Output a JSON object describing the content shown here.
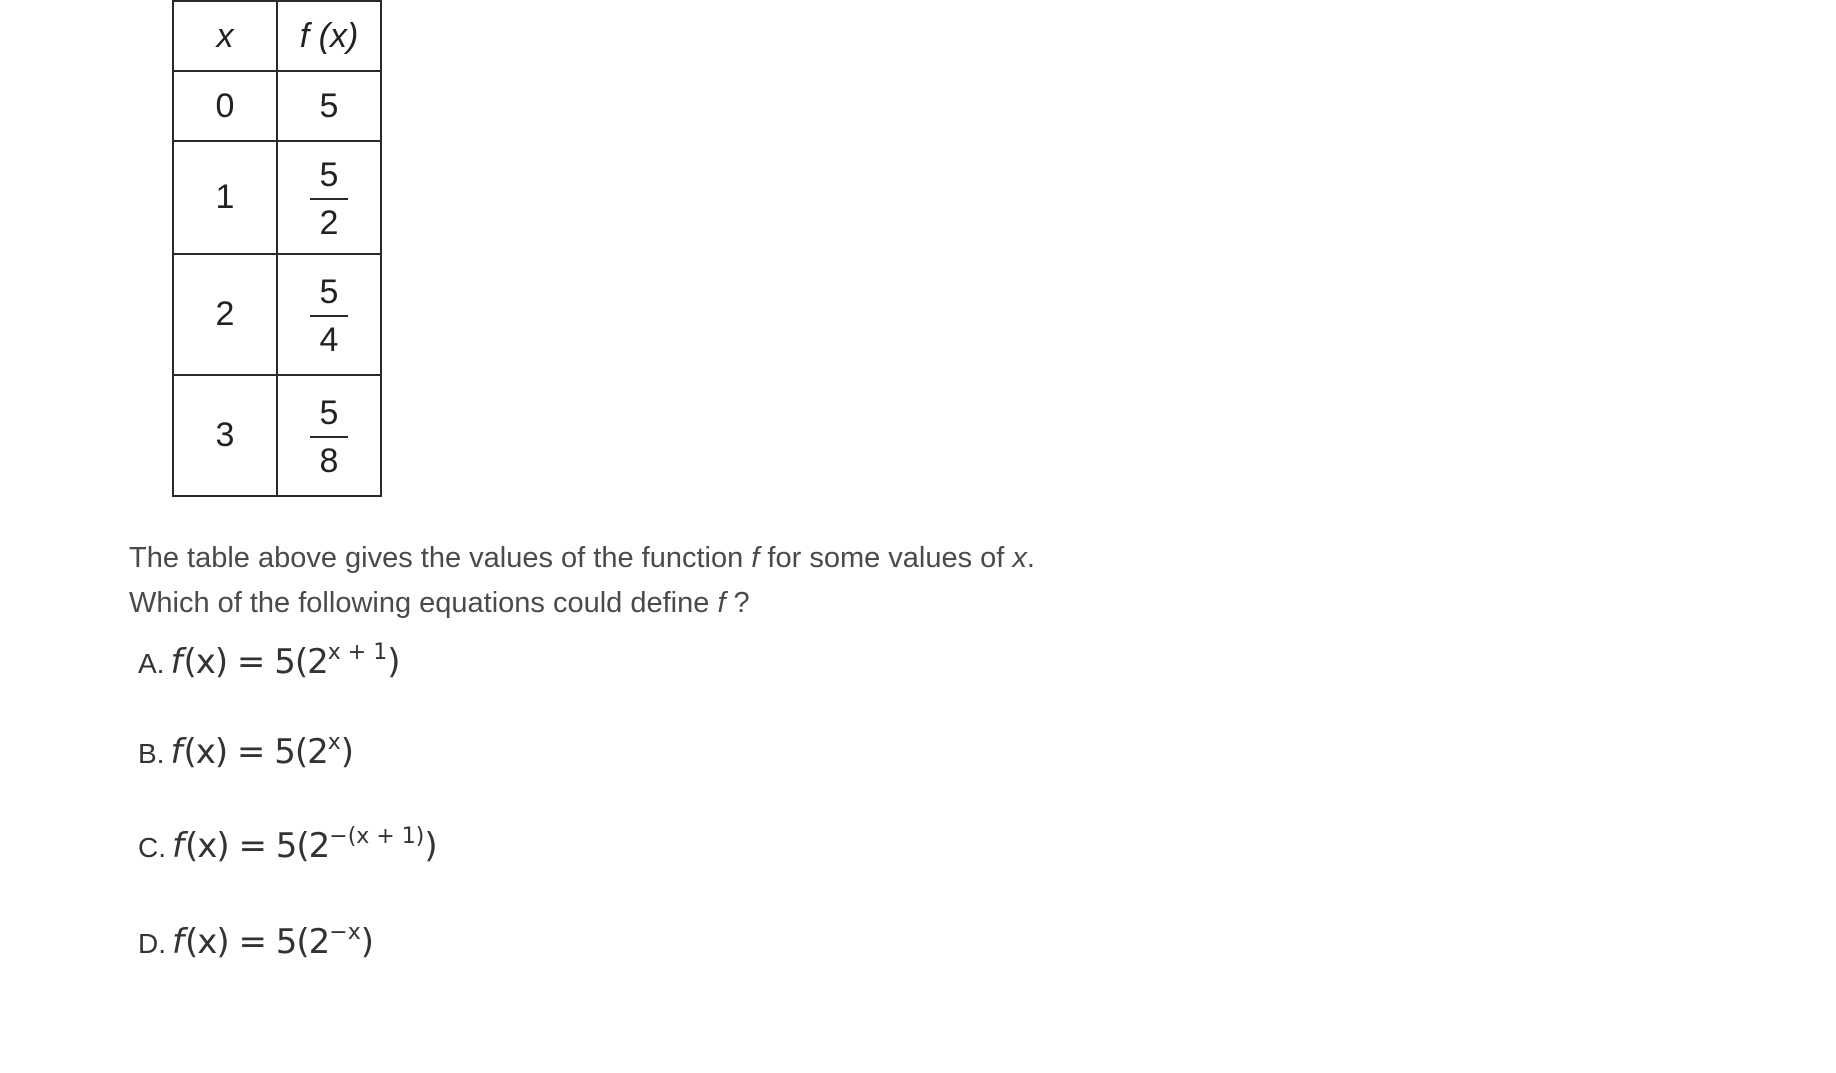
{
  "table": {
    "header_x": "x",
    "header_f_fn": "f",
    "header_f_arg": "(x)",
    "rows": [
      {
        "x": "0",
        "fx_whole": "5"
      },
      {
        "x": "1",
        "fx_num": "5",
        "fx_den": "2"
      },
      {
        "x": "2",
        "fx_num": "5",
        "fx_den": "4"
      },
      {
        "x": "3",
        "fx_num": "5",
        "fx_den": "8"
      }
    ]
  },
  "question": {
    "line1_a": "The table above gives the values of the function ",
    "line1_f": "f",
    "line1_b": " for some values of ",
    "line1_x": "x",
    "line1_c": ".",
    "line2_a": "Which of the following equations could define ",
    "line2_f": "f",
    "line2_b": " ?"
  },
  "choices": [
    {
      "letter": "A.",
      "lhs_fn": "f",
      "lhs_arg": "(x)",
      "rhs": " = 5(2",
      "exponent": "x + 1",
      "close": ")"
    },
    {
      "letter": "B.",
      "lhs_fn": "f",
      "lhs_arg": "(x)",
      "rhs": " = 5(2",
      "exponent": "x",
      "close": ")"
    },
    {
      "letter": "C.",
      "lhs_fn": "f",
      "lhs_arg": "(x)",
      "rhs": " = 5(2",
      "exponent": "−(x + 1)",
      "close": ")"
    },
    {
      "letter": "D.",
      "lhs_fn": "f",
      "lhs_arg": "(x)",
      "rhs": " = 5(2",
      "exponent": "−x",
      "close": ")"
    }
  ]
}
